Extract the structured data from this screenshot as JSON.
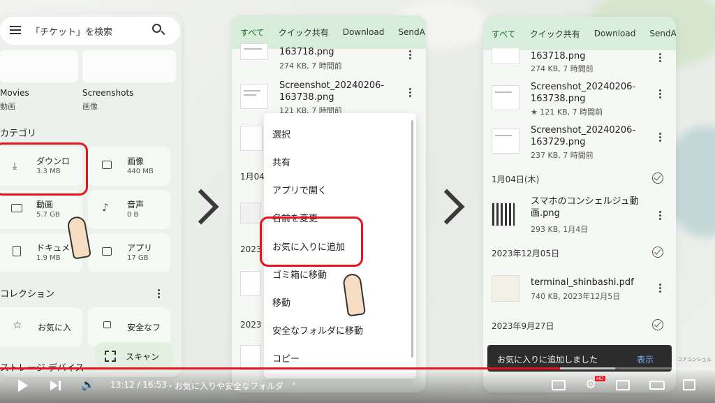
{
  "panel1": {
    "search_placeholder": "「チケット」を検索",
    "recent": [
      {
        "label": "Movies",
        "sub": "動画"
      },
      {
        "label": "Screenshots",
        "sub": "画像"
      }
    ],
    "categories_header": "カテゴリ",
    "categories": [
      {
        "name": "ダウンロ",
        "size": "3.3 MB",
        "icon": "download-icon"
      },
      {
        "name": "画像",
        "size": "440 MB",
        "icon": "image-icon"
      },
      {
        "name": "動画",
        "size": "5.7 GB",
        "icon": "video-icon"
      },
      {
        "name": "音声",
        "size": "0 B",
        "icon": "music-icon"
      },
      {
        "name": "ドキュメ",
        "size": "1.9 MB",
        "icon": "document-icon"
      },
      {
        "name": "アプリ",
        "size": "17 GB",
        "icon": "apps-icon"
      }
    ],
    "collections_header": "コレクション",
    "collections": [
      {
        "name": "お気に入",
        "icon": "star-icon"
      },
      {
        "name": "安全なフ",
        "icon": "lock-icon"
      }
    ],
    "storage_header": "ストレージ デバイス",
    "scan_label": "スキャン"
  },
  "panel2": {
    "tabs": [
      "すべて",
      "クイック共有",
      "Download",
      "SendA"
    ],
    "files": [
      {
        "name": "163718.png",
        "meta": "274 KB, 7 時間前"
      },
      {
        "name": "Screenshot_20240206-163738.png",
        "meta": "121 KB, 7 時間前"
      }
    ],
    "date_headers": [
      "1月04",
      "2023",
      "2023"
    ],
    "menu": [
      "選択",
      "共有",
      "アプリで開く",
      "名前を変更",
      "お気に入りに追加",
      "ゴミ箱に移動",
      "移動",
      "安全なフォルダに移動",
      "コピー"
    ]
  },
  "panel3": {
    "tabs": [
      "すべて",
      "クイック共有",
      "Download",
      "SendA"
    ],
    "files": [
      {
        "name": "163718.png",
        "meta": "274 KB, 7 時間前"
      },
      {
        "name": "Screenshot_20240206-163738.png",
        "meta": "★ 121 KB, 7 時間前"
      },
      {
        "name": "Screenshot_20240206-163729.png",
        "meta": "237 KB, 7 時間前"
      }
    ],
    "date1": "1月04日(木)",
    "file_jan": {
      "name": "スマホのコンシェルジュ動画.png",
      "meta": "293 KB, 1月4日"
    },
    "date2": "2023年12月05日",
    "file_dec": {
      "name": "terminal_shinbashi.pdf",
      "meta": "740 KB, 2023年12月5日"
    },
    "date3": "2023年9月27日",
    "snackbar_text": "お気に入りに追加しました",
    "snackbar_action": "表示"
  },
  "watermark": "コアコンシェル",
  "player": {
    "time": "13:12 / 16:53",
    "chapter": "・お気に入りや安全なフォルダ",
    "progress_percent": 78.3,
    "hd_badge": "HD"
  }
}
